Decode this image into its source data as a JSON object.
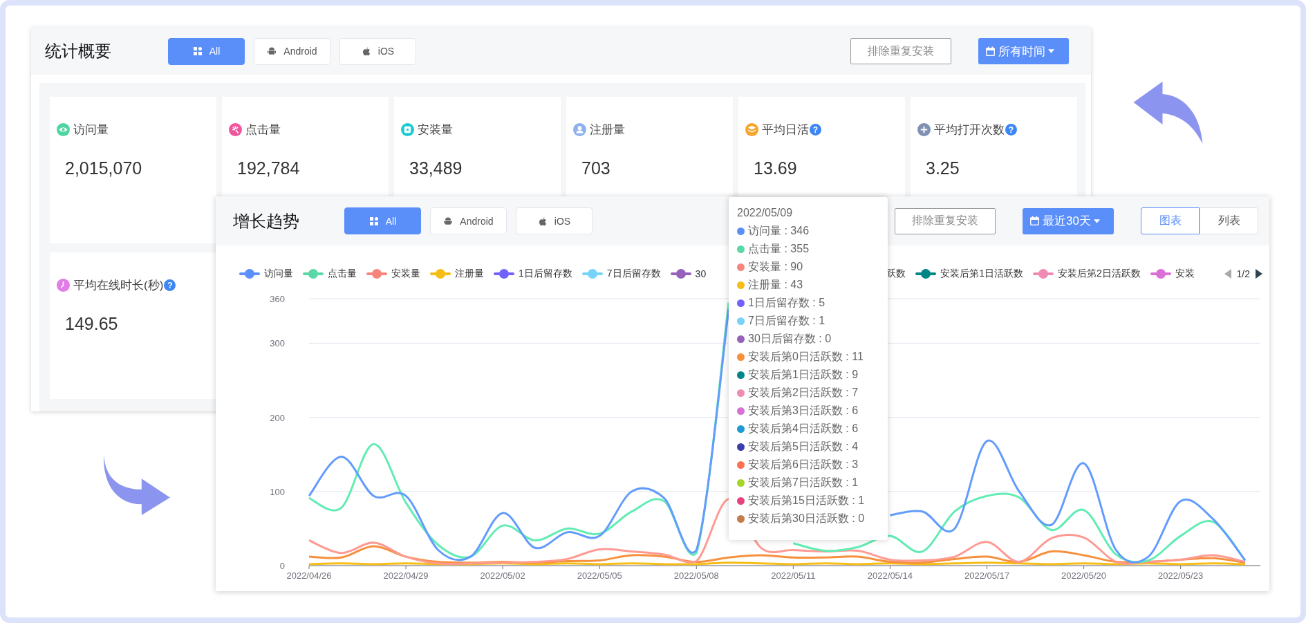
{
  "overview": {
    "title": "统计概要",
    "tabs": [
      {
        "label": "All",
        "selected": true
      },
      {
        "label": "Android",
        "selected": false
      },
      {
        "label": "iOS",
        "selected": false
      }
    ],
    "dedupe_button": "排除重复安装",
    "time_filter": "所有时间",
    "cards": [
      {
        "label": "访问量",
        "value": "2,015,070",
        "color": "#4fd5a2"
      },
      {
        "label": "点击量",
        "value": "192,784",
        "color": "#f0569f"
      },
      {
        "label": "安装量",
        "value": "33,489",
        "color": "#19cbd2"
      },
      {
        "label": "注册量",
        "value": "703",
        "color": "#8fb1ee"
      },
      {
        "label": "平均日活",
        "value": "13.69",
        "color": "#f6a52a",
        "help": "?"
      },
      {
        "label": "平均打开次数",
        "value": "3.25",
        "color": "#7e90b4",
        "help": "?"
      },
      {
        "label": "平均在线时长(秒)",
        "value": "149.65",
        "color": "#e27ce6",
        "help": "?"
      }
    ]
  },
  "trend": {
    "title": "增长趋势",
    "tabs": [
      {
        "label": "All",
        "selected": true
      },
      {
        "label": "Android",
        "selected": false
      },
      {
        "label": "iOS",
        "selected": false
      }
    ],
    "dedupe_button": "排除重复安装",
    "time_filter": "最近30天",
    "view_tabs": [
      {
        "label": "图表",
        "selected": true
      },
      {
        "label": "列表",
        "selected": false
      }
    ],
    "legend": [
      {
        "label": "访问量",
        "color": "#5b8ff9"
      },
      {
        "label": "点击量",
        "color": "#5ad8a6"
      },
      {
        "label": "安装量",
        "color": "#f6867d"
      },
      {
        "label": "注册量",
        "color": "#f6bd16"
      },
      {
        "label": "1日后留存数",
        "color": "#7262fd"
      },
      {
        "label": "7日后留存数",
        "color": "#78d3f8"
      },
      {
        "label": "30",
        "color": "#9661bc"
      },
      {
        "label": "跃数",
        "cut_left": true
      },
      {
        "label": "安装后第1日活跃数",
        "color": "#008685"
      },
      {
        "label": "安装后第2日活跃数",
        "color": "#f08bb4"
      },
      {
        "label": "安装",
        "color": "#d971d7"
      }
    ],
    "legend_pager": {
      "label": "1/2",
      "prev_disabled": true,
      "next_disabled": false
    },
    "chart_data": {
      "type": "line",
      "categories": [
        "2022/04/26",
        null,
        null,
        "2022/04/29",
        null,
        null,
        "2022/05/02",
        null,
        null,
        "2022/05/05",
        null,
        null,
        "2022/05/08",
        null,
        null,
        "2022/05/11",
        null,
        null,
        "2022/05/14",
        null,
        null,
        "2022/05/17",
        null,
        null,
        "2022/05/20",
        null,
        null,
        "2022/05/23",
        null,
        null
      ],
      "ylim": [
        0,
        360
      ],
      "yticks": [
        0,
        100,
        200,
        300,
        360
      ],
      "grid": true,
      "series": [
        {
          "color": "#f6bd16",
          "values": [
            2,
            3,
            2,
            3,
            2,
            2,
            3,
            2,
            3,
            2,
            3,
            2,
            2,
            4,
            3,
            2,
            3,
            2,
            3,
            2,
            3,
            4,
            3,
            2,
            3,
            2,
            3,
            2,
            3,
            2
          ]
        },
        {
          "color": "#f6903d",
          "values": [
            12,
            11,
            26,
            12,
            5,
            4,
            5,
            4,
            6,
            7,
            14,
            12,
            5,
            11,
            14,
            11,
            11,
            12,
            5,
            4,
            9,
            12,
            5,
            19,
            14,
            5,
            5,
            8,
            10,
            4
          ]
        },
        {
          "color": "#ff9a93",
          "values": [
            34,
            17,
            31,
            12,
            3,
            3,
            4,
            5,
            9,
            22,
            19,
            15,
            6,
            90,
            24,
            21,
            19,
            20,
            8,
            7,
            12,
            32,
            5,
            37,
            38,
            5,
            5,
            8,
            14,
            5
          ]
        },
        {
          "color": "#62ecb4",
          "values": [
            91,
            78,
            164,
            85,
            28,
            12,
            54,
            34,
            50,
            43,
            73,
            87,
            17,
            355,
            null,
            30,
            20,
            25,
            40,
            19,
            73,
            94,
            92,
            48,
            75,
            15,
            7,
            40,
            59,
            7
          ]
        },
        {
          "color": "#639cfc",
          "values": [
            94,
            147,
            94,
            94,
            21,
            12,
            71,
            24,
            45,
            40,
            100,
            91,
            21,
            346,
            null,
            null,
            null,
            null,
            68,
            73,
            50,
            168,
            100,
            55,
            138,
            21,
            12,
            87,
            63,
            7
          ]
        }
      ]
    },
    "tooltip": {
      "date": "2022/05/09",
      "items": [
        {
          "text": "访问量 : 346",
          "color": "#5b8ff9"
        },
        {
          "text": "点击量 : 355",
          "color": "#5ad8a6"
        },
        {
          "text": "安装量 : 90",
          "color": "#f6867d"
        },
        {
          "text": "注册量 : 43",
          "color": "#f6bd16"
        },
        {
          "text": "1日后留存数 : 5",
          "color": "#7262fd"
        },
        {
          "text": "7日后留存数 : 1",
          "color": "#78d3f8"
        },
        {
          "text": "30日后留存数 : 0",
          "color": "#9661bc"
        },
        {
          "text": "安装后第0日活跃数 : 11",
          "color": "#f6903d"
        },
        {
          "text": "安装后第1日活跃数 : 9",
          "color": "#008685"
        },
        {
          "text": "安装后第2日活跃数 : 7",
          "color": "#f08bb4"
        },
        {
          "text": "安装后第3日活跃数 : 6",
          "color": "#d971d7"
        },
        {
          "text": "安装后第4日活跃数 : 6",
          "color": "#1e9bd3"
        },
        {
          "text": "安装后第5日活跃数 : 4",
          "color": "#3c3fab"
        },
        {
          "text": "安装后第6日活跃数 : 3",
          "color": "#ff7050"
        },
        {
          "text": "安装后第7日活跃数 : 1",
          "color": "#a5d628"
        },
        {
          "text": "安装后第15日活跃数 : 1",
          "color": "#e8417f"
        },
        {
          "text": "安装后第30日活跃数 : 0",
          "color": "#c57b4a"
        }
      ]
    }
  }
}
